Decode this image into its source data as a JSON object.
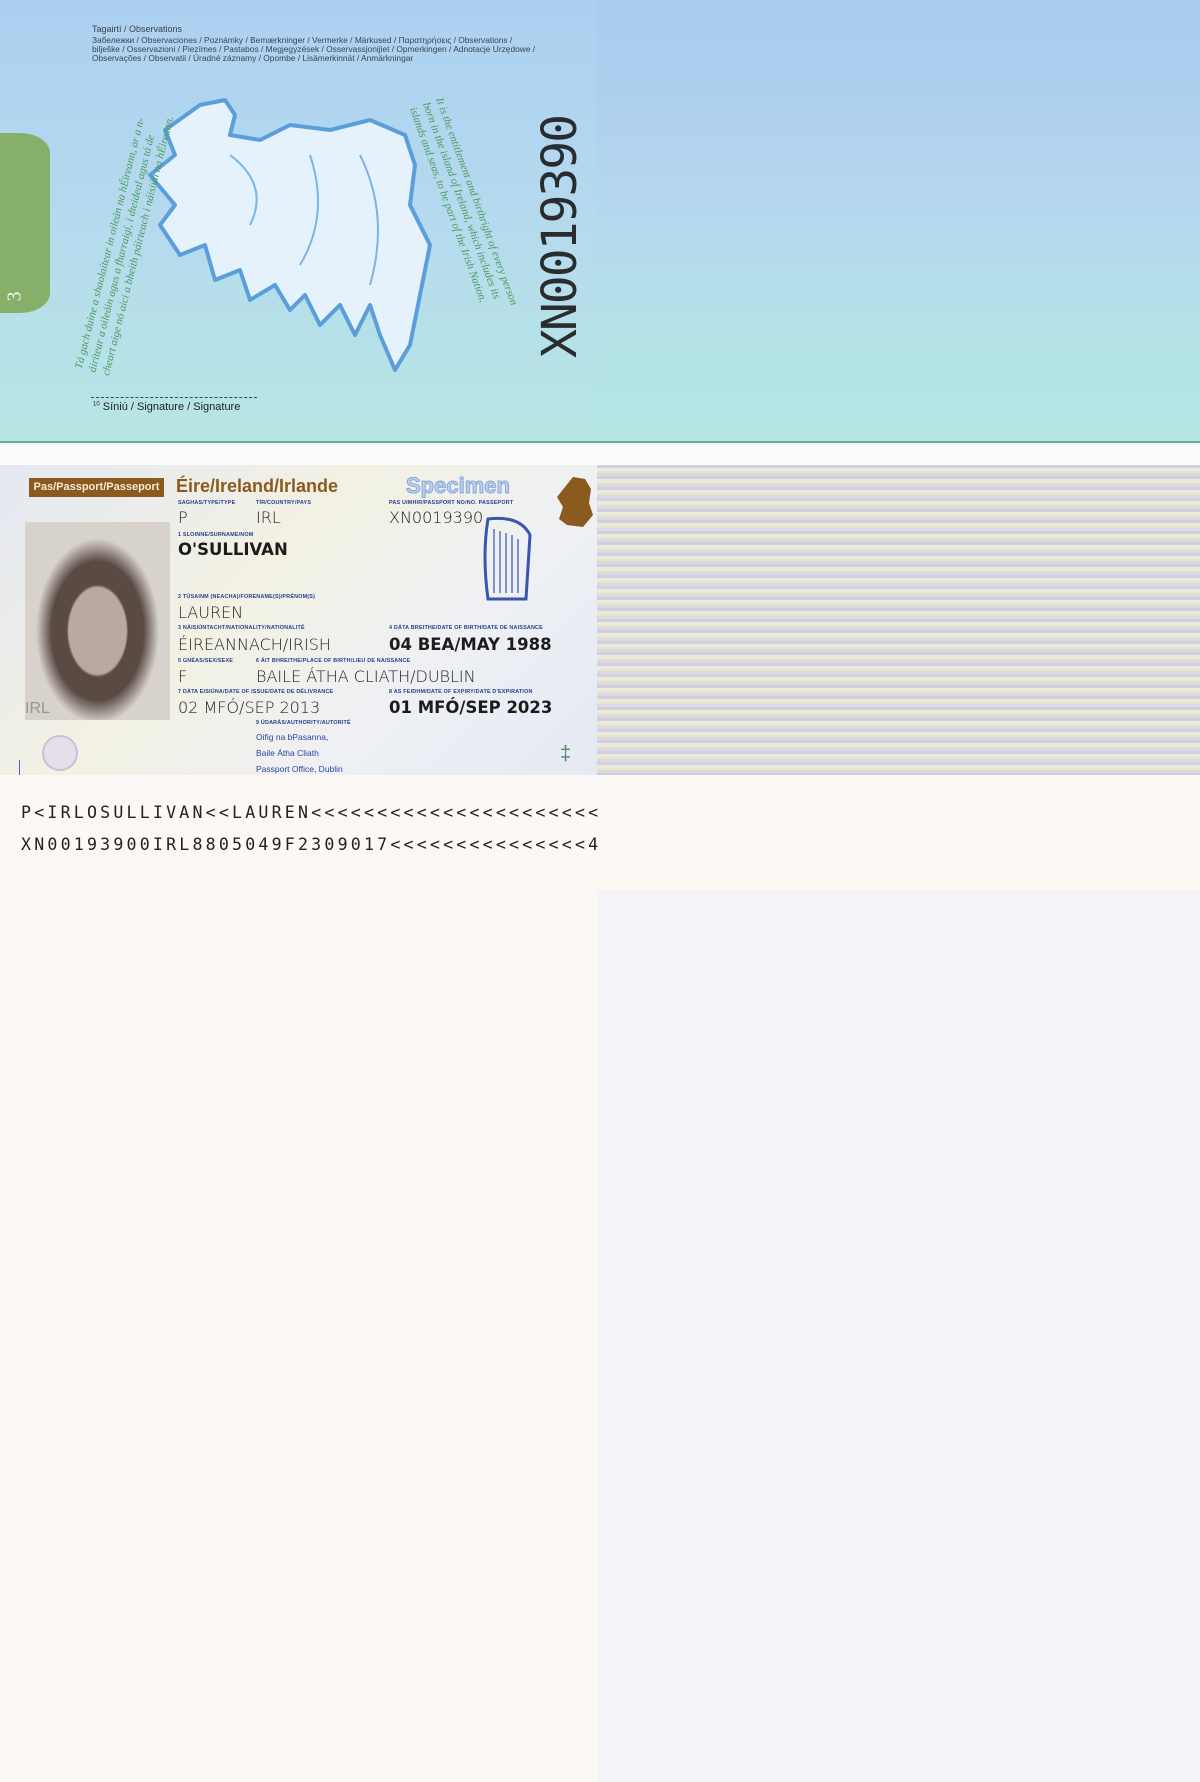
{
  "observations_page": {
    "page_number": "3",
    "heading": "Tagairtí / Observations",
    "lines": [
      "Забележки / Observaciones / Poznámky / Bemærkninger / Vermerke / Märkused / Παρατηρήσεις / Observations /",
      "bilješke / Osservazioni  / Piezīmes / Pastabos / Megjegyzések / Osservassjonijiet / Opmerkingen / Adnotacje Urzędowe /",
      "Observações / Observatii / Úradné záznamy / Opombe / Lisämerkinnät / Anmärkningar"
    ],
    "irish_statement": "Tá gach duine a shaolaítear in oileán na hÉireann, ar a n-áirítear a oileáin agus a fharraigí, i dteideal agus tá de cheart aige nó aici a bheith páirteach i náisiún na hÉireann.",
    "english_statement": "It is the entitlement and birthright of every person born in the island of Ireland, which includes its islands and seas, to be part of the Irish Nation.",
    "perforated_number": "XN0019390",
    "signature_label": "Síniú / Signature / Signature",
    "signature_number": "10"
  },
  "data_page": {
    "doc_label": "Pas/Passport/Passeport",
    "country_title": "Éire/Ireland/Irlande",
    "specimen": "Specimen",
    "photo_overlay": "IRL",
    "fields": {
      "type_label": "SAGHAS/TYPE/TYPE",
      "type": "P",
      "country_label": "TÍR/COUNTRY/PAYS",
      "country": "IRL",
      "passport_no_label": "PAS UIMHIR/PASSPORT NO/NO. PASSEPORT",
      "passport_no": "XN0019390",
      "surname_label": "1 SLOINNE/SURNAME/NOM",
      "surname": "O'SULLIVAN",
      "forename_label": "2 TÚSAINM (NEACHA)/FORENAME(S)/PRÉNOM(S)",
      "forename": "LAUREN",
      "nationality_label": "3 NÁISIÚNTACHT/NATIONALITY/NATIONALITÉ",
      "nationality": "ÉIREANNACH/IRISH",
      "dob_label": "4 DÁTA BREITHE/DATE OF BIRTH/DATE DE NAISSANCE",
      "dob": "04 BEA/MAY 1988",
      "sex_label": "5 GNÉAS/SEX/SEXE",
      "sex": "F",
      "pob_label": "6 ÁIT BHREITHE/PLACE OF BIRTH/LIEU DE NAISSANCE",
      "pob": "BAILE ÁTHA CLIATH/DUBLIN",
      "issue_label": "7 DÁTA EISIÚNA/DATE OF ISSUE/DATE DE DÉLIVRANCE",
      "issue": "02 MFÓ/SEP 2013",
      "expiry_label": "8 AS FEIDHM/DATE OF EXPIRY/DATE D'EXPIRATION",
      "expiry": "01 MFÓ/SEP 2023",
      "authority_label": "9 ÚDARÁS/AUTHORITY/AUTORITÉ",
      "authority": [
        "Oifig na bPasanna,",
        "Baile Átha Cliath",
        "Passport Office, Dublin"
      ]
    },
    "mrz": [
      "P<IRLOSULLIVAN<<LAUREN<<<<<<<<<<<<<<<<<<<<<<",
      "XN00193900IRL8805049F2309017<<<<<<<<<<<<<<<4"
    ]
  },
  "colors": {
    "brand_brown": "#8a5a1e",
    "label_blue": "#243e8f",
    "statement_green": "#4d9a5c",
    "tab_green": "#86b06a"
  }
}
